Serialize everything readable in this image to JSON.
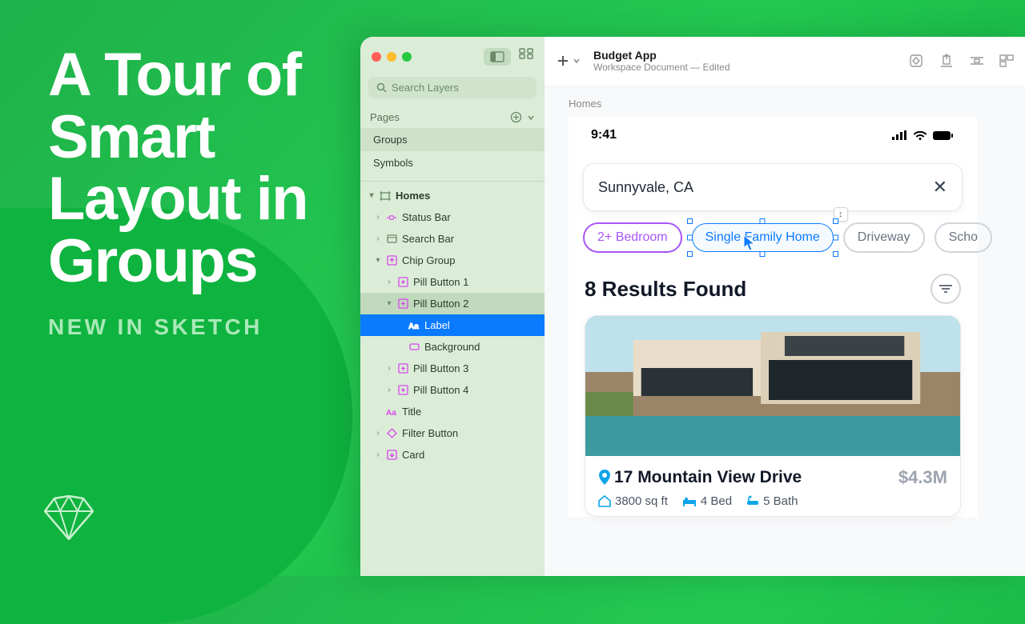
{
  "promo": {
    "headline": "A Tour of Smart Layout in Groups",
    "subhead": "NEW IN SKETCH"
  },
  "window": {
    "search_placeholder": "Search Layers",
    "pages_label": "Pages",
    "pages": [
      "Groups",
      "Symbols"
    ],
    "doc_title": "Budget App",
    "doc_subtitle": "Workspace Document — Edited"
  },
  "layers": {
    "artboard": "Homes",
    "status_bar": "Status Bar",
    "search_bar": "Search Bar",
    "chip_group": "Chip Group",
    "pill1": "Pill Button 1",
    "pill2": "Pill Button 2",
    "pill2_label": "Label",
    "pill2_bg": "Background",
    "pill3": "Pill Button 3",
    "pill4": "Pill Button 4",
    "title": "Title",
    "filter_btn": "Filter Button",
    "card": "Card"
  },
  "canvas": {
    "artboard_label": "Homes",
    "status_time": "9:41",
    "search_value": "Sunnyvale, CA",
    "chips": {
      "bedroom": "2+ Bedroom",
      "single_family": "Single Family Home",
      "driveway": "Driveway",
      "school": "Scho"
    },
    "results_title": "8 Results Found",
    "card": {
      "address": "17 Mountain View Drive",
      "price": "$4.3M",
      "sqft": "3800 sq ft",
      "beds": "4 Bed",
      "baths": "5 Bath"
    }
  }
}
